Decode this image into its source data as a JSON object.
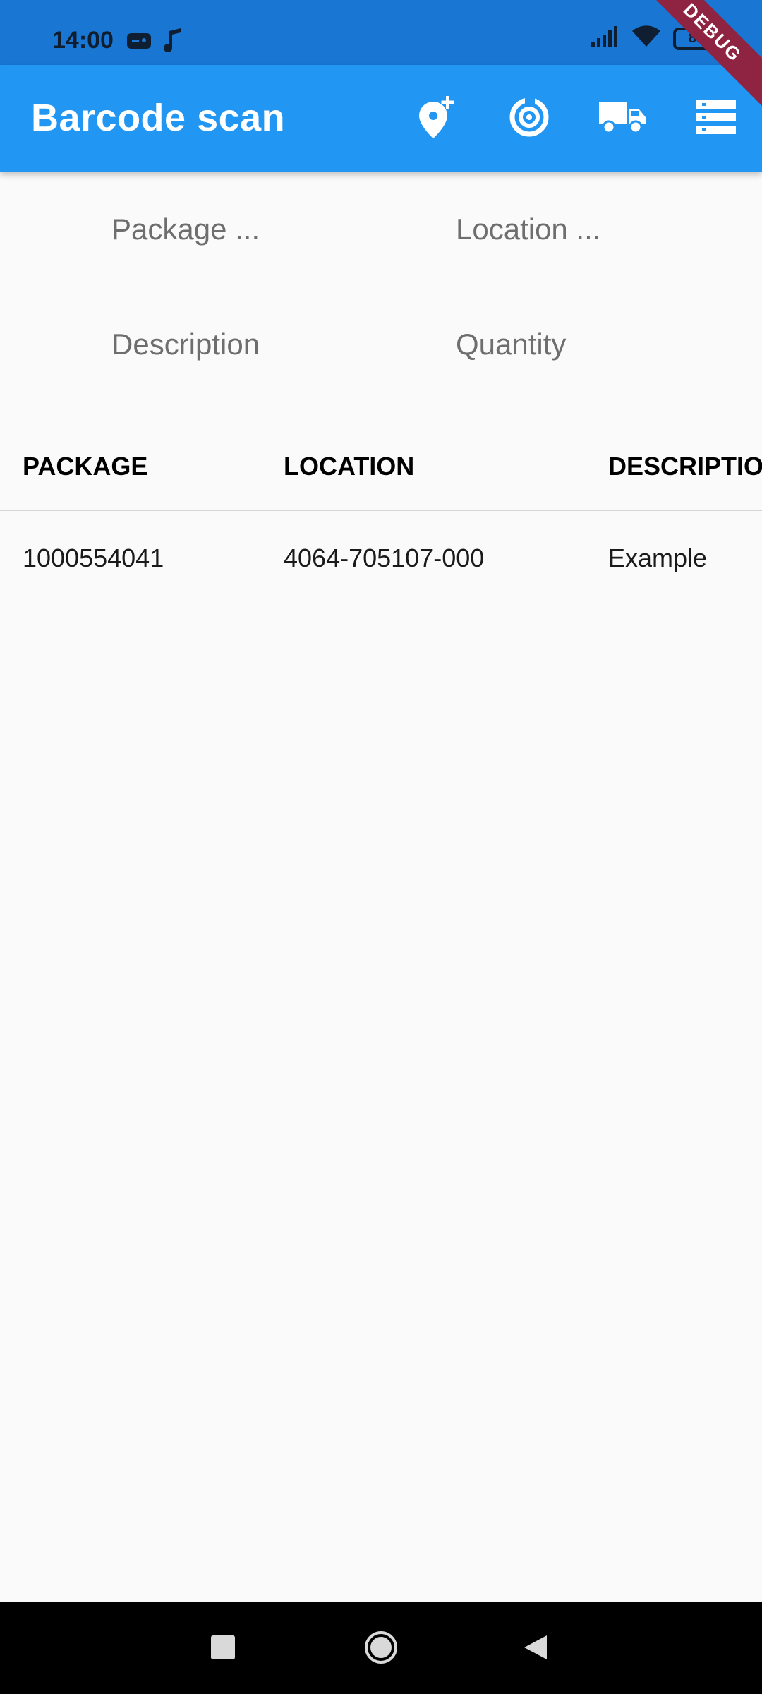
{
  "status_bar": {
    "time": "14:00",
    "left_icons": [
      "gamepad-icon",
      "music-note-icon"
    ],
    "right_icons": [
      "signal-icon",
      "wifi-icon",
      "battery-icon"
    ],
    "battery_level": "81"
  },
  "debug_banner": "DEBUG",
  "app_bar": {
    "title": "Barcode scan",
    "actions": [
      "add-location-icon",
      "scan-target-icon",
      "truck-icon",
      "list-icon"
    ]
  },
  "form": {
    "package_placeholder": "Package ...",
    "location_placeholder": "Location ...",
    "description_placeholder": "Description",
    "quantity_placeholder": "Quantity"
  },
  "table": {
    "columns": [
      "PACKAGE",
      "LOCATION",
      "DESCRIPTIO"
    ],
    "rows": [
      [
        "1000554041",
        "4064-705107-000",
        "Example"
      ]
    ]
  },
  "colors": {
    "status_bar": "#1976D2",
    "app_bar": "#2196F3",
    "debug_ribbon": "#8E2442",
    "background": "#FAFAFA"
  },
  "nav_bar": {
    "buttons": [
      "recents-icon",
      "home-icon",
      "back-icon"
    ]
  }
}
